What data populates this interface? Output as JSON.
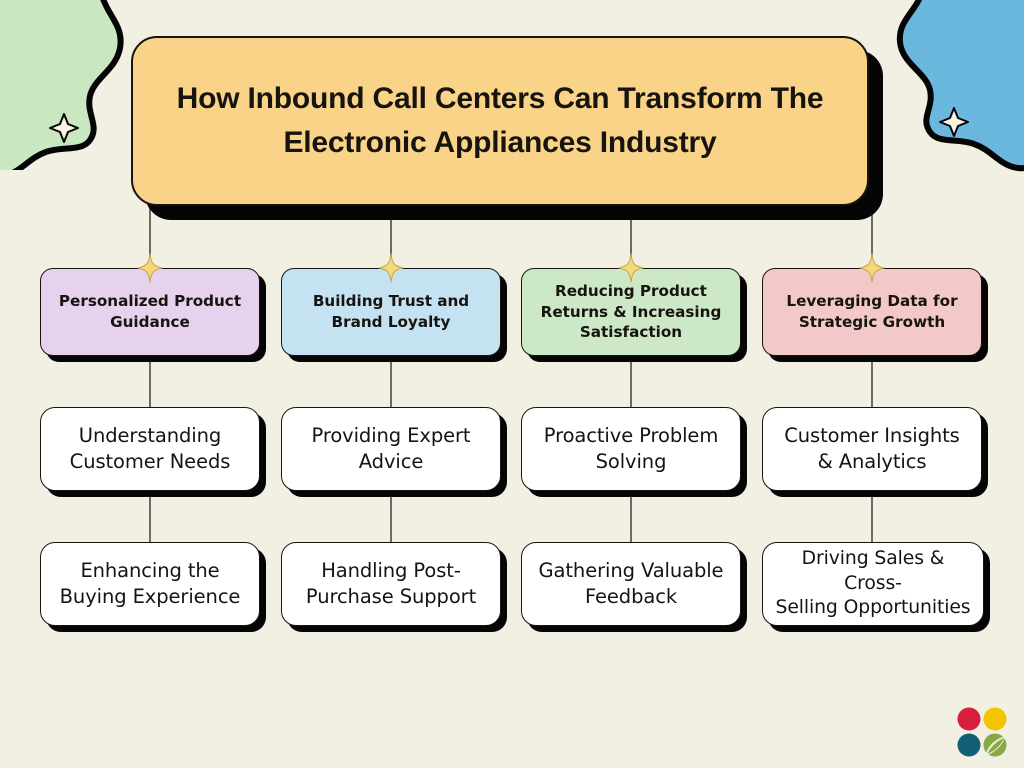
{
  "page": {
    "background_color": "#F2EFE3",
    "title": "How Inbound Call Centers Can Transform The Electronic Appliances Industry",
    "title_line1": "How Inbound Call Centers Can Transform The",
    "title_line2": "Electronic Appliances Industry",
    "title_fill": "#F9D387"
  },
  "decor": {
    "blob_top_left_color": "#C9E7C0",
    "blob_top_right_color": "#6BB8DF",
    "blob_outline_color": "#050505",
    "star_fill": "#FAF3E2",
    "sparkle_fill": "#F5D87D",
    "sparkle_stroke": "#C9A84C",
    "connector_color": "#4a4a46"
  },
  "branches": [
    {
      "category": {
        "label": "Personalized Product Guidance",
        "line1": "Personalized Product",
        "line2": "Guidance",
        "color": "#E6D2EC"
      },
      "items": [
        {
          "label": "Understanding Customer Needs",
          "line1": "Understanding",
          "line2": "Customer Needs"
        },
        {
          "label": "Enhancing the Buying Experience",
          "line1": "Enhancing the",
          "line2": "Buying Experience"
        }
      ]
    },
    {
      "category": {
        "label": "Building Trust and Brand Loyalty",
        "line1": "Building Trust and",
        "line2": "Brand Loyalty",
        "color": "#C5E2F2"
      },
      "items": [
        {
          "label": "Providing Expert Advice",
          "line1": "Providing Expert",
          "line2": "Advice"
        },
        {
          "label": "Handling Post-Purchase Support",
          "line1": "Handling Post-",
          "line2": "Purchase Support"
        }
      ]
    },
    {
      "category": {
        "label": "Reducing Product Returns & Increasing Satisfaction",
        "line1": "Reducing Product",
        "line2": "Returns & Increasing",
        "line3": "Satisfaction",
        "color": "#CDE8C6"
      },
      "items": [
        {
          "label": "Proactive Problem Solving",
          "line1": "Proactive Problem",
          "line2": "Solving"
        },
        {
          "label": "Gathering Valuable Feedback",
          "line1": "Gathering Valuable",
          "line2": "Feedback"
        }
      ]
    },
    {
      "category": {
        "label": "Leveraging Data for Strategic Growth",
        "line1": "Leveraging Data for",
        "line2": "Strategic Growth",
        "color": "#F2C8C8"
      },
      "items": [
        {
          "label": "Customer Insights & Analytics",
          "line1": "Customer Insights",
          "line2": "& Analytics"
        },
        {
          "label": "Driving Sales & Cross-Selling Opportunities",
          "line1": "Driving Sales & Cross-",
          "line2": "Selling Opportunities"
        }
      ]
    }
  ],
  "logo": {
    "name": "four-dot-logo",
    "colors": {
      "red": "#D81E3C",
      "yellow": "#F4C400",
      "teal": "#125E72",
      "green": "#86A943",
      "swoosh": "#F2EFE3"
    }
  }
}
